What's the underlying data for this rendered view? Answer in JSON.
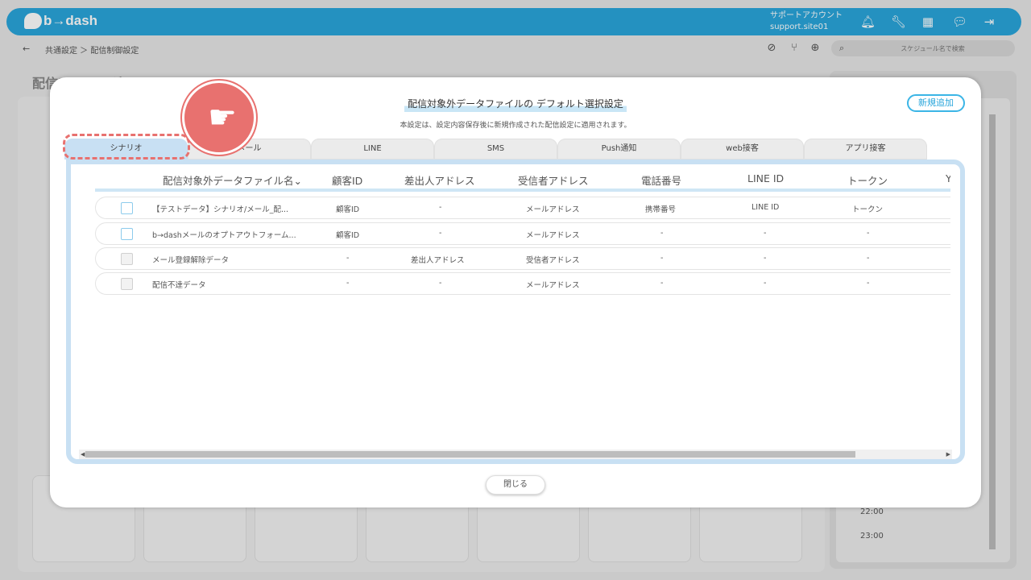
{
  "app": {
    "logo_text": "b→dash",
    "account_name": "サポートアカウント",
    "account_id": "support.site01"
  },
  "breadcrumb": {
    "back_icon": "←",
    "path": "共通設定 ＞ 配信制御設定"
  },
  "search": {
    "placeholder": "スケジュール名で検索"
  },
  "background": {
    "page_title": "配信アカレンダ",
    "time_1": "22:00",
    "time_2": "23:00"
  },
  "modal": {
    "title": "配信対象外データファイルの デフォルト選択設定",
    "subtitle": "本設定は、設定内容保存後に新規作成された配信設定に適用されます。",
    "add_button": "新規追加",
    "close_button": "閉じる",
    "tabs": [
      {
        "label": "シナリオ",
        "active": true
      },
      {
        "label": "メール",
        "active": false
      },
      {
        "label": "LINE",
        "active": false
      },
      {
        "label": "SMS",
        "active": false
      },
      {
        "label": "Push通知",
        "active": false
      },
      {
        "label": "web接客",
        "active": false
      },
      {
        "label": "アプリ接客",
        "active": false
      }
    ],
    "table": {
      "columns": [
        "配信対象外データファイル名",
        "顧客ID",
        "差出人アドレス",
        "受信者アドレス",
        "電話番号",
        "LINE ID",
        "トークン",
        "Y"
      ],
      "sort_icon": "⌄",
      "rows": [
        {
          "name": "【テストデータ】シナリオ/メール_配...",
          "customer_id": "顧客ID",
          "sender": "-",
          "recipient": "メールアドレス",
          "phone": "携帯番号",
          "line_id": "LINE ID",
          "token": "トークン",
          "enabled": true
        },
        {
          "name": "b→dashメールのオプトアウトフォーム...",
          "customer_id": "顧客ID",
          "sender": "-",
          "recipient": "メールアドレス",
          "phone": "-",
          "line_id": "-",
          "token": "-",
          "enabled": true
        },
        {
          "name": "メール登録解除データ",
          "customer_id": "-",
          "sender": "差出人アドレス",
          "recipient": "受信者アドレス",
          "phone": "-",
          "line_id": "-",
          "token": "-",
          "enabled": false
        },
        {
          "name": "配信不達データ",
          "customer_id": "-",
          "sender": "-",
          "recipient": "メールアドレス",
          "phone": "-",
          "line_id": "-",
          "token": "-",
          "enabled": false
        }
      ]
    }
  },
  "colors": {
    "brand": "#2aa6db",
    "tab_active": "#c8e0f3",
    "highlight": "#e8716f"
  }
}
